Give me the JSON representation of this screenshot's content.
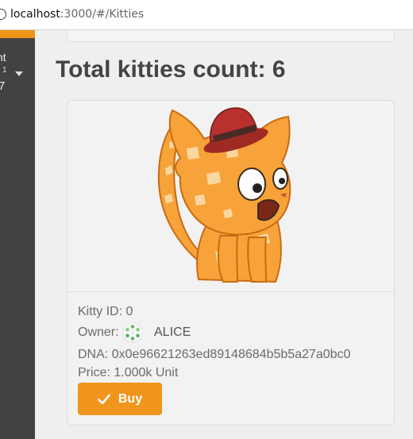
{
  "browser": {
    "url_host": "localhost",
    "url_path": ":3000/#/Kitties"
  },
  "sidebar": {
    "account_name_fragment": "nt",
    "account_sub_fragment": "1",
    "account_number_fragment": "7"
  },
  "main": {
    "title": "Total kitties count: 6",
    "kitty": {
      "id_line": "Kitty ID: 0",
      "owner_label": "Owner:",
      "owner_name": "ALICE",
      "dna_line": "DNA: 0x0e96621263ed89148684b5b5a27a0bc0",
      "price_line": "Price: 1.000k Unit",
      "buy_label": "Buy"
    }
  },
  "colors": {
    "accent": "#f0941c",
    "sidebar_bg": "#424242",
    "kitty_body": "#f7a33a",
    "hat": "#b8312f"
  },
  "icons": [
    "info-icon",
    "dropdown-caret-icon",
    "identicon-avatar",
    "checkmark-icon"
  ]
}
